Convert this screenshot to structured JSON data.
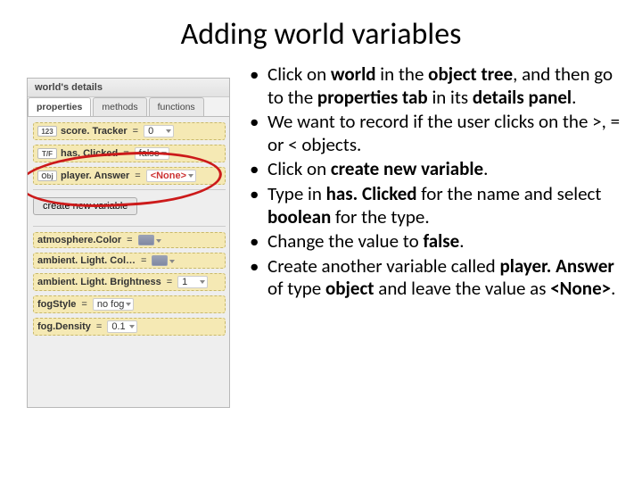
{
  "title": "Adding world variables",
  "panel": {
    "header": "world's details",
    "tabs": {
      "properties": "properties",
      "methods": "methods",
      "functions": "functions"
    },
    "vars": {
      "score": {
        "type": "123",
        "name": "score. Tracker",
        "value": "0"
      },
      "hasClicked": {
        "type": "T/F",
        "name": "has. Clicked",
        "value": "false"
      },
      "playerAnswer": {
        "type": "Obj",
        "name": "player. Answer",
        "value": "<None>"
      }
    },
    "createVarBtn": "create new variable",
    "props": {
      "atmColor": {
        "name": "atmosphere.Color"
      },
      "ambLightColor": {
        "name": "ambient. Light. Col…"
      },
      "ambLightBright": {
        "name": "ambient. Light. Brightness",
        "value": "1"
      },
      "fogStyle": {
        "name": "fogStyle",
        "value": "no fog"
      },
      "fogDensity": {
        "name": "fog.Density",
        "value": "0.1"
      }
    }
  },
  "bullets": {
    "b1a": "Click on ",
    "b1_world": "world",
    "b1b": " in the ",
    "b1_tree": "object tree",
    "b1c": ", and then go to the ",
    "b1_prop": "properties tab",
    "b1d": " in its ",
    "b1_details": "details panel",
    "b1e": ".",
    "b2": "We want to record if the user clicks on the >, = or < objects.",
    "b3a": "Click on ",
    "b3_cnv": "create new variable",
    "b3b": ".",
    "b4a": "Type in ",
    "b4_has": "has. Clicked",
    "b4b": " for the name and select ",
    "b4_bool": "boolean",
    "b4c": " for the type.",
    "b5a": "Change the value to ",
    "b5_false": "false",
    "b5b": ".",
    "b6a": "Create another variable called ",
    "b6_pa": "player. Answer",
    "b6b": " of type ",
    "b6_obj": "object",
    "b6c": " and leave the value as ",
    "b6_none": "<None>",
    "b6d": "."
  }
}
